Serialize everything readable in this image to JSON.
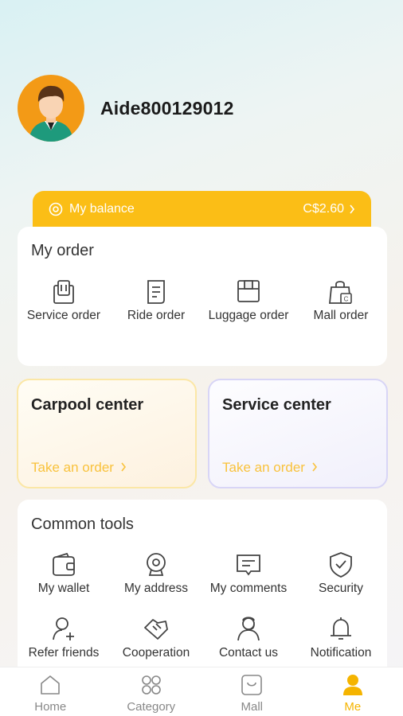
{
  "profile": {
    "username": "Aide800129012",
    "avatar_icon": "user-avatar"
  },
  "balance": {
    "label": "My balance",
    "value": "C$2.60",
    "accent": "#fbbe16"
  },
  "my_order": {
    "title": "My order",
    "items": [
      {
        "label": "Service order",
        "icon": "service-order-icon"
      },
      {
        "label": "Ride order",
        "icon": "ride-order-icon"
      },
      {
        "label": "Luggage order",
        "icon": "luggage-order-icon"
      },
      {
        "label": "Mall order",
        "icon": "mall-order-icon"
      }
    ]
  },
  "centers": {
    "carpool": {
      "title": "Carpool center",
      "link": "Take an order"
    },
    "service": {
      "title": "Service center",
      "link": "Take an order"
    }
  },
  "tools": {
    "title": "Common tools",
    "items": [
      {
        "label": "My wallet",
        "icon": "wallet-icon"
      },
      {
        "label": "My address",
        "icon": "address-icon"
      },
      {
        "label": "My comments",
        "icon": "comments-icon"
      },
      {
        "label": "Security",
        "icon": "shield-icon"
      },
      {
        "label": "Refer friends",
        "icon": "add-user-icon"
      },
      {
        "label": "Cooperation",
        "icon": "handshake-icon"
      },
      {
        "label": "Contact us",
        "icon": "contact-icon"
      },
      {
        "label": "Notification",
        "icon": "bell-icon"
      }
    ]
  },
  "tabs": [
    {
      "label": "Home",
      "icon": "home-icon"
    },
    {
      "label": "Category",
      "icon": "category-icon"
    },
    {
      "label": "Mall",
      "icon": "mall-icon"
    },
    {
      "label": "Me",
      "icon": "me-icon",
      "active": true
    }
  ],
  "colors": {
    "accent": "#f5b400",
    "link": "#f9c23c"
  }
}
